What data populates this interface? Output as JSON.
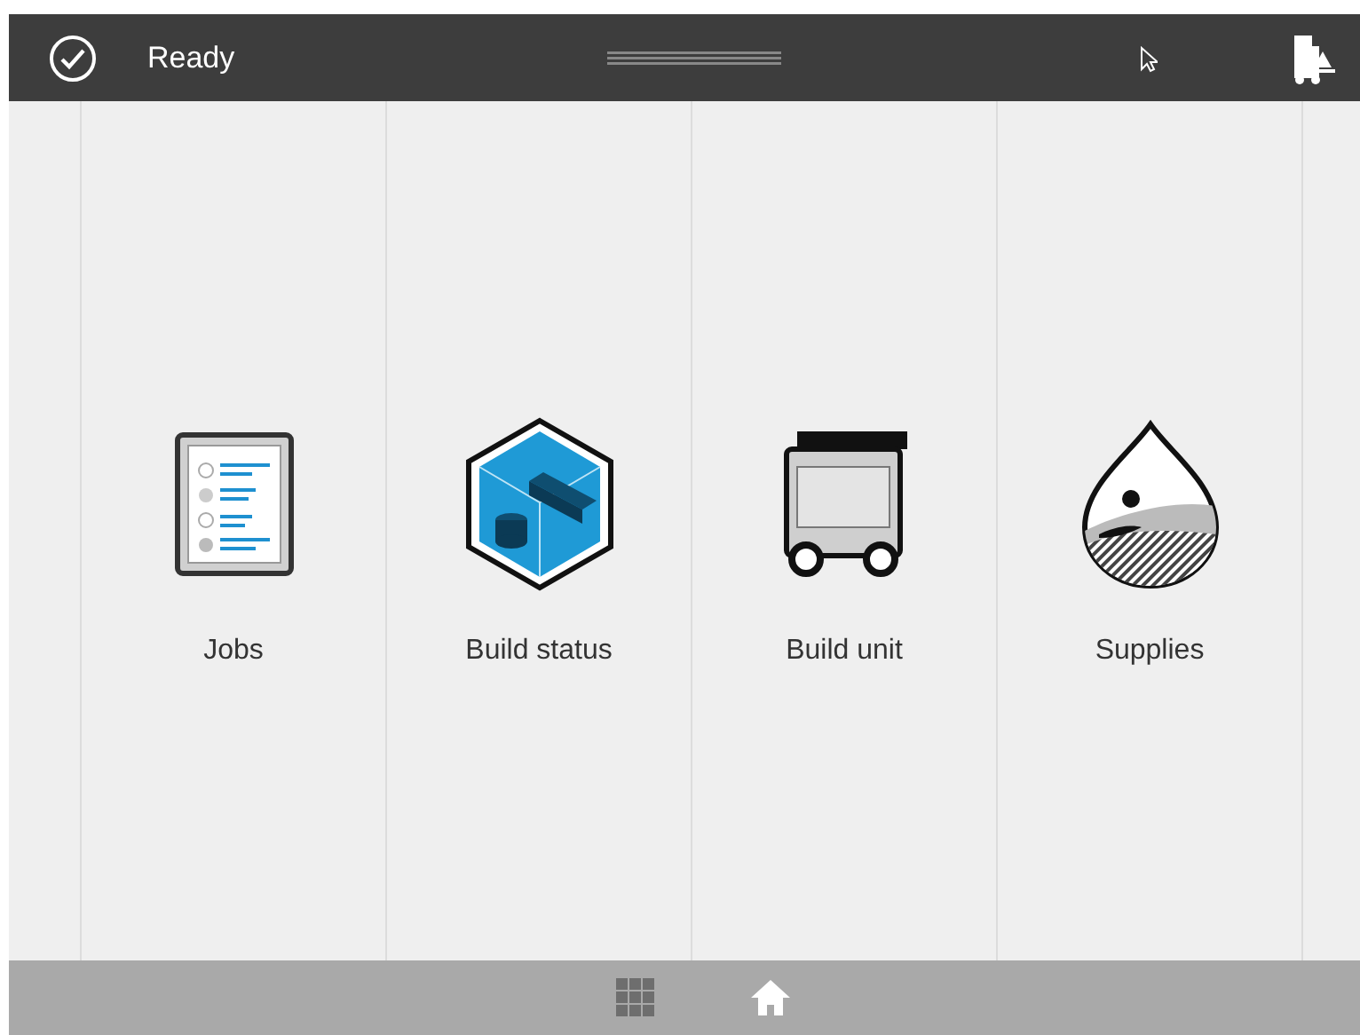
{
  "status_bar": {
    "status": "Ready"
  },
  "tiles": [
    {
      "label": "Jobs",
      "kind": "jobs"
    },
    {
      "label": "Build status",
      "kind": "build-status"
    },
    {
      "label": "Build unit",
      "kind": "build-unit"
    },
    {
      "label": "Supplies",
      "kind": "supplies"
    }
  ],
  "nav": [
    {
      "kind": "apps",
      "selected": false
    },
    {
      "kind": "home",
      "selected": true
    }
  ]
}
